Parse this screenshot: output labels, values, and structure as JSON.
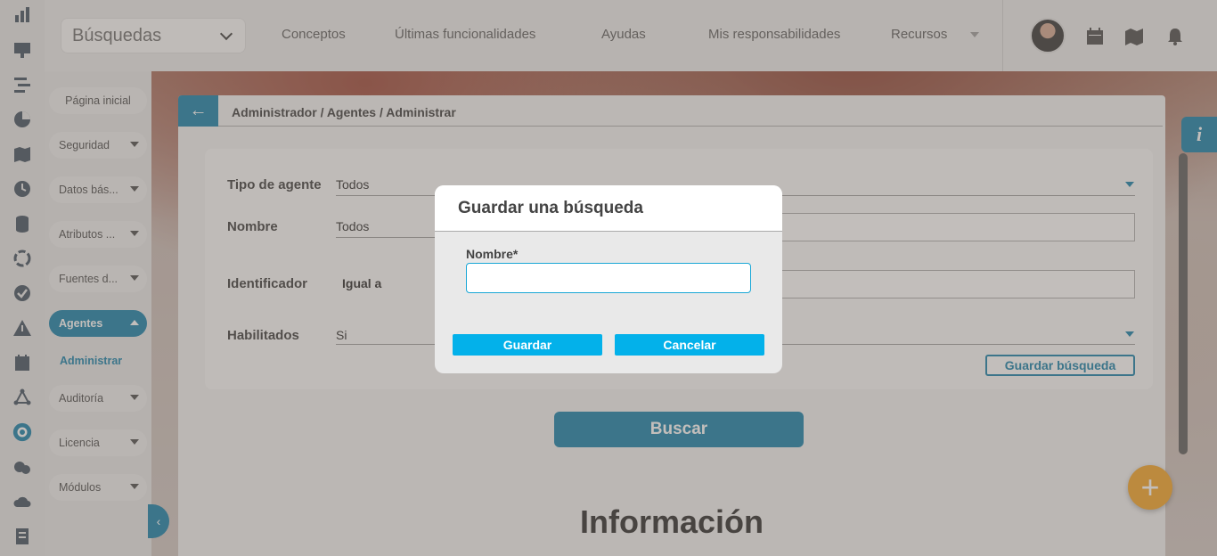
{
  "topbar": {
    "search_select": "Búsquedas",
    "nav": [
      "Conceptos",
      "Últimas funcionalidades",
      "Ayudas",
      "Mis responsabilidades",
      "Recursos"
    ]
  },
  "sidebar": {
    "items": [
      {
        "label": "Página inicial"
      },
      {
        "label": "Seguridad"
      },
      {
        "label": "Datos bás..."
      },
      {
        "label": "Atributos ..."
      },
      {
        "label": "Fuentes d..."
      },
      {
        "label": "Agentes"
      },
      {
        "label": "Auditoría"
      },
      {
        "label": "Licencia"
      },
      {
        "label": "Módulos"
      }
    ],
    "active_sub": "Administrar"
  },
  "main": {
    "breadcrumb": "Administrador / Agentes / Administrar",
    "fields": [
      {
        "label": "Tipo de agente",
        "value": "Todos"
      },
      {
        "label": "Nombre",
        "value": "Todos"
      },
      {
        "label": "Identificador",
        "value": "Igual a"
      },
      {
        "label": "Habilitados",
        "value": "Si"
      }
    ],
    "save_search_label": "Guardar búsqueda",
    "search_button": "Buscar",
    "info_title": "Información"
  },
  "info_tab": "i",
  "fab_symbol": "+",
  "modal": {
    "title": "Guardar una búsqueda",
    "name_label": "Nombre*",
    "name_value": "",
    "save_label": "Guardar",
    "cancel_label": "Cancelar"
  },
  "colors": {
    "primary": "#0b7aa6",
    "modal_button": "#03b1ea",
    "fab": "#f5a11c"
  }
}
